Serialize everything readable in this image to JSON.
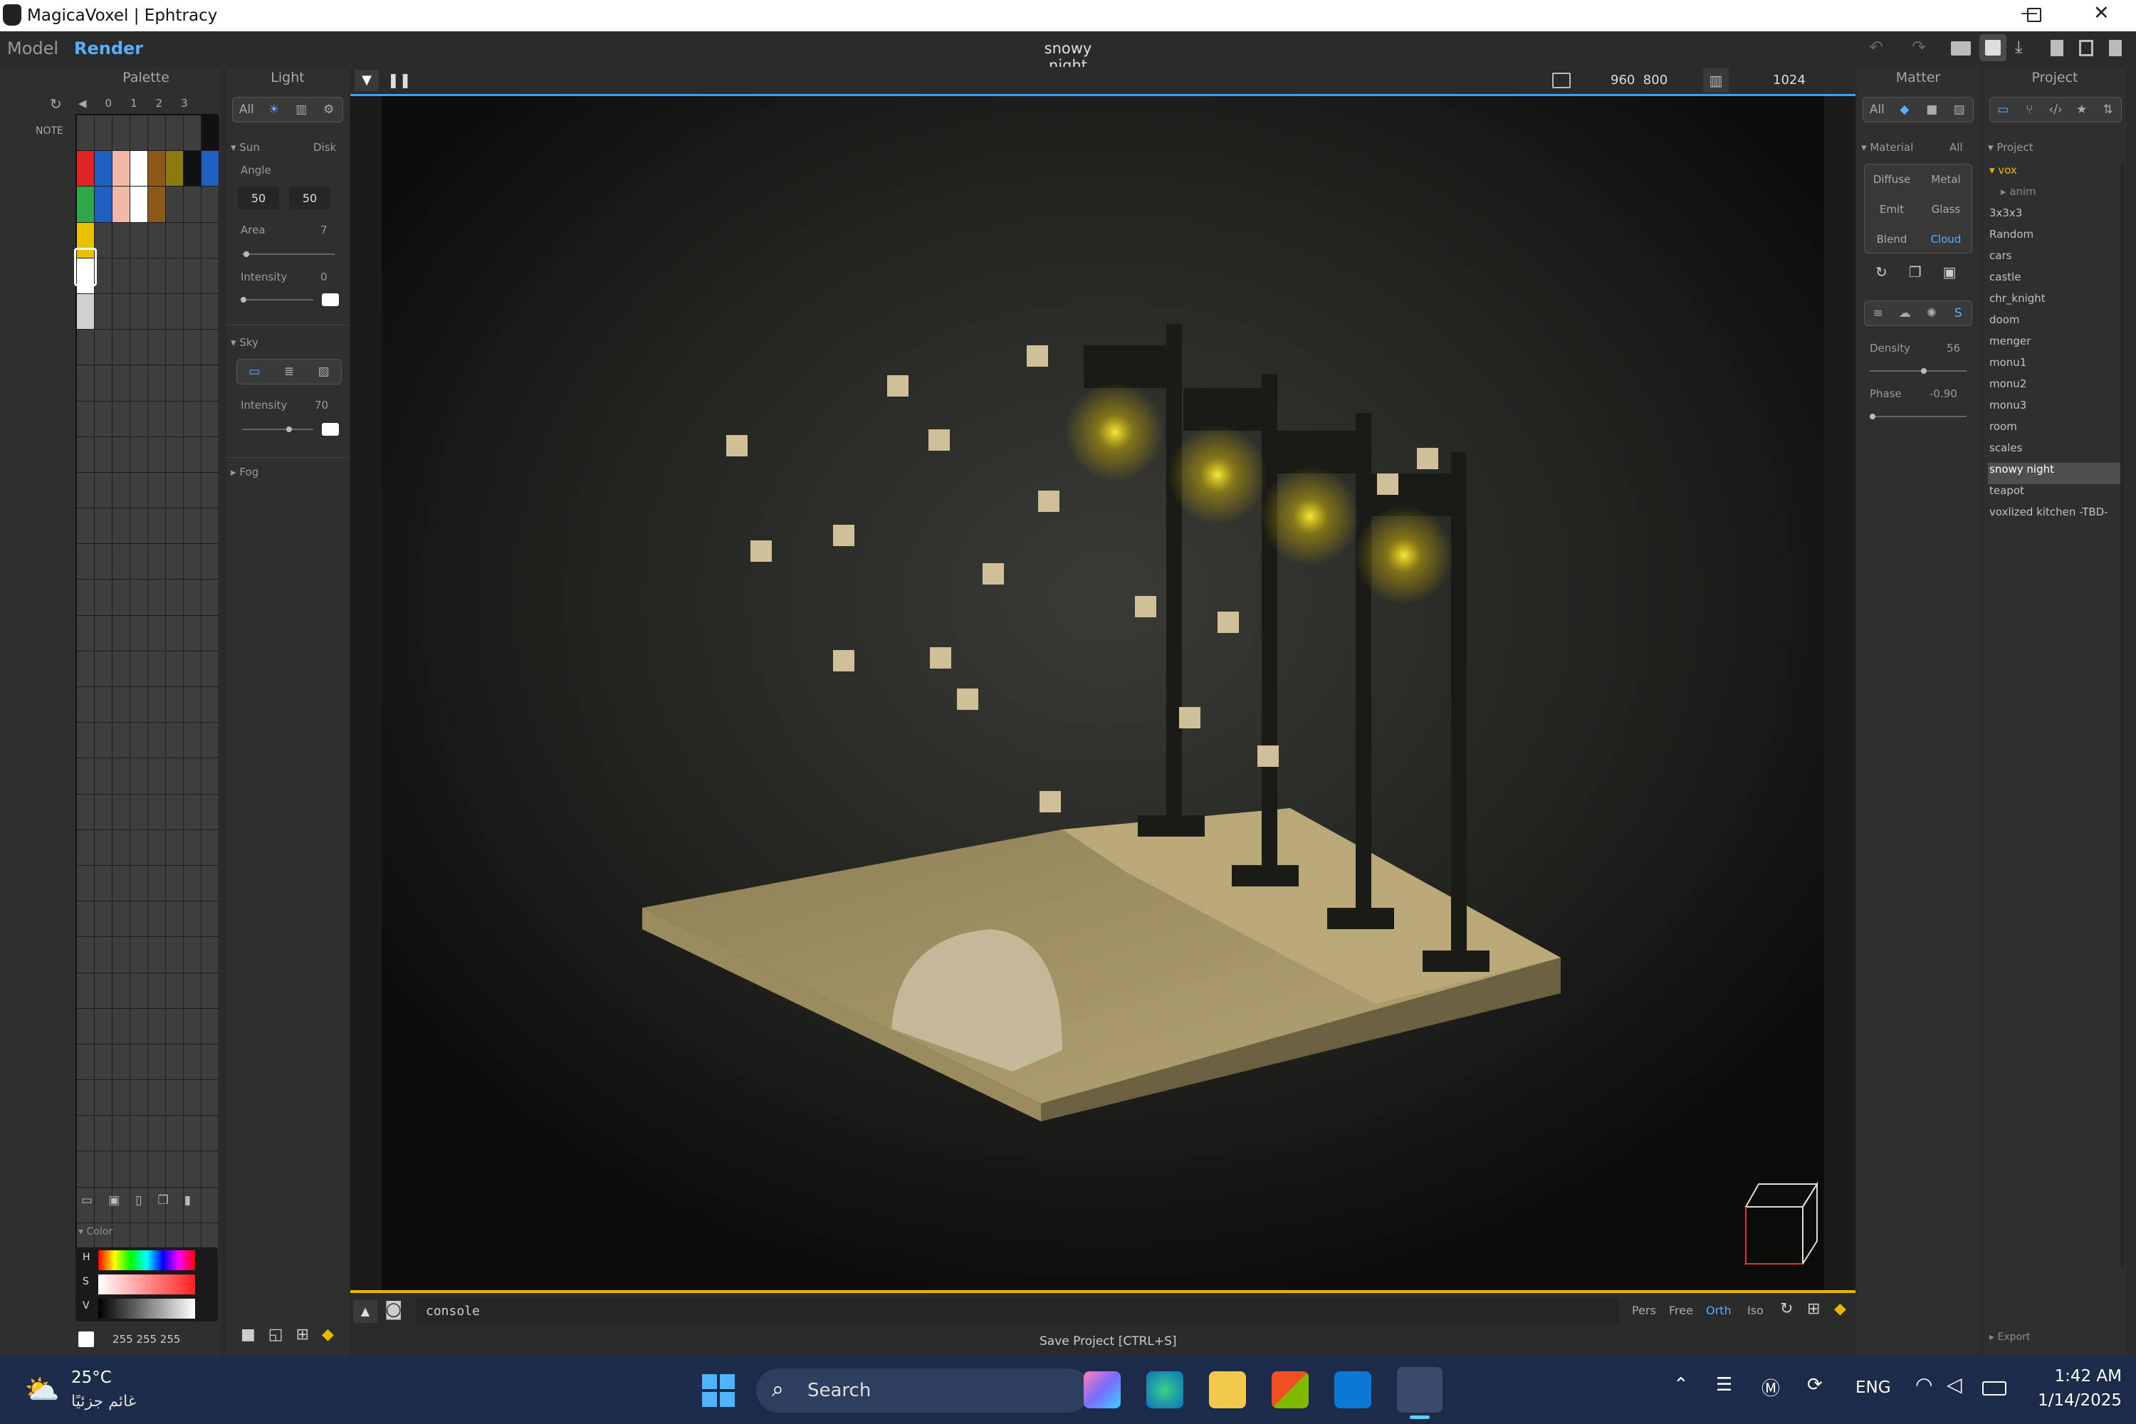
{
  "app": {
    "title": "MagicaVoxel | Ephtracy"
  },
  "window_controls": {
    "minimize": "—",
    "restore": "❐",
    "close": "✕"
  },
  "menu": {
    "model": "Model",
    "render": "Render",
    "project_name": "snowy night"
  },
  "palette": {
    "title": "Palette",
    "note": "NOTE",
    "pages": [
      "◀",
      "0",
      "1",
      "2",
      "3"
    ],
    "colors": {
      "red": "#e02424",
      "blue": "#1e5fbf",
      "peach": "#f2b8a8",
      "white": "#ffffff",
      "brown": "#8b5a1a",
      "olive": "#8a7a10",
      "dark": "#111111",
      "green": "#2fa84a",
      "yellow": "#e8c200",
      "lightgray": "#d0d0d0"
    },
    "color_section": "Color",
    "hsv_labels": [
      "H",
      "S",
      "V"
    ],
    "rgb_value": "255 255 255"
  },
  "light": {
    "title": "Light",
    "filters": [
      "All"
    ],
    "sun_label": "Sun",
    "disk_label": "Disk",
    "angle_label": "Angle",
    "angle_values": [
      "50",
      "50"
    ],
    "area_label": "Area",
    "area_value": "7",
    "intensity_label": "Intensity",
    "intensity_value": "0",
    "sky_label": "Sky",
    "sky_intensity_label": "Intensity",
    "sky_intensity_value": "70",
    "fog_label": "Fog"
  },
  "viewport": {
    "resolution": "960  800",
    "samples": "1024",
    "console": "console",
    "camera_modes": [
      "Pers",
      "Free",
      "Orth",
      "Iso"
    ],
    "active_mode": "Orth",
    "tooltip": "Save Project [CTRL+S]",
    "colors": {
      "accent": "#3aa0ff",
      "bottom_accent": "#e6b800",
      "lamp_glow": "#fff23a"
    }
  },
  "matter": {
    "title": "Matter",
    "filter_all": "All",
    "material_label": "Material",
    "material_all": "All",
    "materials": [
      "Diffuse",
      "Metal",
      "Emit",
      "Glass",
      "Blend",
      "Cloud"
    ],
    "active_material": "Cloud",
    "s_label": "S",
    "density_label": "Density",
    "density_value": "56",
    "phase_label": "Phase",
    "phase_value": "-0.90"
  },
  "project": {
    "title": "Project",
    "section": "Project",
    "folder": "vox",
    "subfolder": "anim",
    "items": [
      "3x3x3",
      "Random",
      "cars",
      "castle",
      "chr_knight",
      "doom",
      "menger",
      "monu1",
      "monu2",
      "monu3",
      "room",
      "scales",
      "snowy night",
      "teapot",
      "voxlized kitchen -TBD-"
    ],
    "selected": "snowy night",
    "export": "Export"
  },
  "taskbar": {
    "temperature": "25°C",
    "weather": "غائم جزئيًا",
    "search": "Search",
    "lang": "ENG",
    "time": "1:42 AM",
    "date": "1/14/2025",
    "color": "#1c2b4a"
  }
}
